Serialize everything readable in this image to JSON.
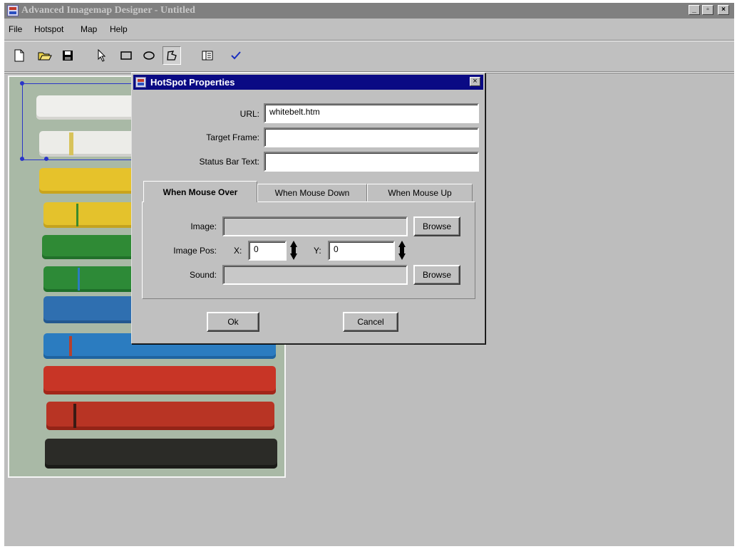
{
  "window": {
    "title": "Advanced Imagemap Designer - Untitled",
    "minimize": "_",
    "restore": "▫",
    "close": "×"
  },
  "menu": [
    "File",
    "Hotspot",
    "Map",
    "Help"
  ],
  "toolbar": {
    "buttons": [
      "new-file-icon",
      "open-folder-icon",
      "save-disk-icon",
      "pointer-arrow-icon",
      "rectangle-tool-icon",
      "ellipse-tool-icon",
      "polygon-tool-icon",
      "properties-panel-icon",
      "checkmark-icon"
    ],
    "selected_tool": "polygon-tool-icon"
  },
  "canvas": {
    "image_description": "belt colors: white, white, yellow, yellow, green, green, blue, blue, red, red, black",
    "belt_colors": [
      "#f1f1ee",
      "#eeeeea",
      "#e8c52c",
      "#e8c52c",
      "#2f8a35",
      "#2d8a37",
      "#2f6fb0",
      "#2b7cc0",
      "#c83526",
      "#b83424",
      "#2b2b27"
    ]
  },
  "dialog": {
    "title": "HotSpot Properties",
    "close": "×",
    "url_label": "URL:",
    "url_value": "whitebelt.htm",
    "target_label": "Target Frame:",
    "target_value": "",
    "status_label": "Status Bar Text:",
    "status_value": "",
    "tabs": [
      "When Mouse Over",
      "When Mouse Down",
      "When Mouse Up"
    ],
    "active_tab": "When Mouse Over",
    "image_label": "Image:",
    "image_value": "",
    "browse": "Browse",
    "image_pos_label": "Image Pos:",
    "x_label": "X:",
    "x_value": "0",
    "y_label": "Y:",
    "y_value": "0",
    "sound_label": "Sound:",
    "sound_value": "",
    "ok": "Ok",
    "cancel": "Cancel"
  }
}
